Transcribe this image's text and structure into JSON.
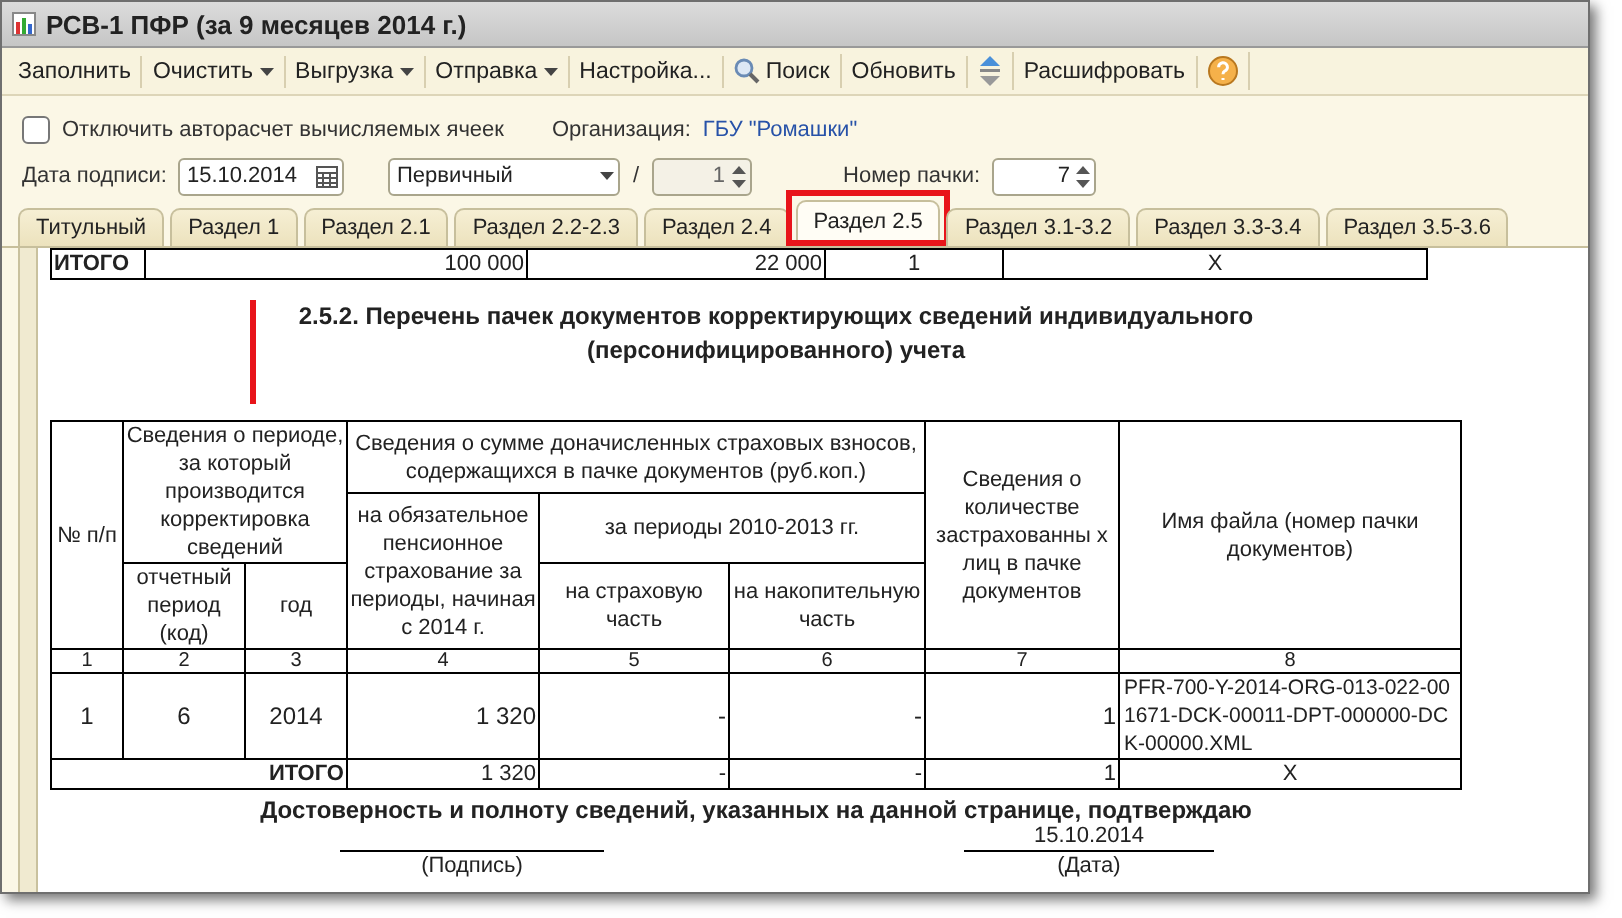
{
  "window": {
    "title": "РСВ-1 ПФР (за 9 месяцев 2014 г.)"
  },
  "toolbar": [
    {
      "kind": "text",
      "label": "Заполнить"
    },
    {
      "kind": "dropdown",
      "label": "Очистить"
    },
    {
      "kind": "dropdown",
      "label": "Выгрузка"
    },
    {
      "kind": "dropdown",
      "label": "Отправка"
    },
    {
      "kind": "text",
      "label": "Настройка..."
    },
    {
      "kind": "search",
      "label": "Поиск"
    },
    {
      "kind": "text",
      "label": "Обновить"
    },
    {
      "kind": "arrows"
    },
    {
      "kind": "text",
      "label": "Расшифровать"
    },
    {
      "kind": "help"
    }
  ],
  "form": {
    "autocalc": {
      "label": "Отключить авторасчет вычисляемых ячеек",
      "checked": false
    },
    "organization": {
      "label": "Организация:",
      "value": "ГБУ \"Ромашки\""
    },
    "signature_date": {
      "label": "Дата подписи:",
      "value": "15.10.2014"
    },
    "report_type": {
      "value": "Первичный"
    },
    "slash": "/",
    "correction_number": {
      "value": "1",
      "disabled": true
    },
    "pack_number": {
      "label": "Номер пачки:",
      "value": "7"
    }
  },
  "tabs": [
    {
      "label": "Титульный",
      "selected": false
    },
    {
      "label": "Раздел 1",
      "selected": false
    },
    {
      "label": "Раздел 2.1",
      "selected": false
    },
    {
      "label": "Раздел 2.2-2.3",
      "selected": false
    },
    {
      "label": "Раздел 2.4",
      "selected": false
    },
    {
      "label": "Раздел 2.5",
      "selected": true
    },
    {
      "label": "Раздел 3.1-3.2",
      "selected": false
    },
    {
      "label": "Раздел 3.3-3.4",
      "selected": false
    },
    {
      "label": "Раздел 3.5-3.6",
      "selected": false
    }
  ],
  "document": {
    "summary_row": [
      "ИТОГО",
      "100 000",
      "22 000",
      "1",
      "X"
    ],
    "section_title": "2.5.2.  Перечень пачек документов корректирующих сведений индивидуального (персонифицированного) учета",
    "header": {
      "number": "№ п/п",
      "period_group": "Сведения о периоде, за который производится корректировка сведений",
      "amount_group": "Сведения о сумме доначисленных страховых взносов, содержащихся в пачке документов (руб.коп.)",
      "mandatory": "на обязательное пенсионное страхование за периоды, начиная с 2014 г.",
      "periods_2010_2013": "за периоды 2010-2013 гг.",
      "reporting_period": "отчетный период (код)",
      "year": "год",
      "insurance_part": "на страховую часть",
      "funded_part": "на накопительную часть",
      "insured_count": "Сведения о количестве застрахованны х лиц в пачке документов",
      "file_name": "Имя файла (номер пачки документов)"
    },
    "column_numbers": [
      "1",
      "2",
      "3",
      "4",
      "5",
      "6",
      "7",
      "8"
    ],
    "rows": [
      [
        "1",
        "6",
        "2014",
        "1 320",
        "-",
        "-",
        "1",
        "PFR-700-Y-2014-ORG-013-022-001671-DCK-00011-DPT-000000-DCK-00000.XML"
      ]
    ],
    "total": [
      "ИТОГО",
      "1 320",
      "-",
      "-",
      "1",
      "X"
    ],
    "confirmation": "Достоверность и полноту сведений, указанных на данной странице, подтверждаю",
    "signature": {
      "caption": "(Подпись)"
    },
    "date": {
      "value": "15.10.2014",
      "caption": "(Дата)"
    }
  }
}
